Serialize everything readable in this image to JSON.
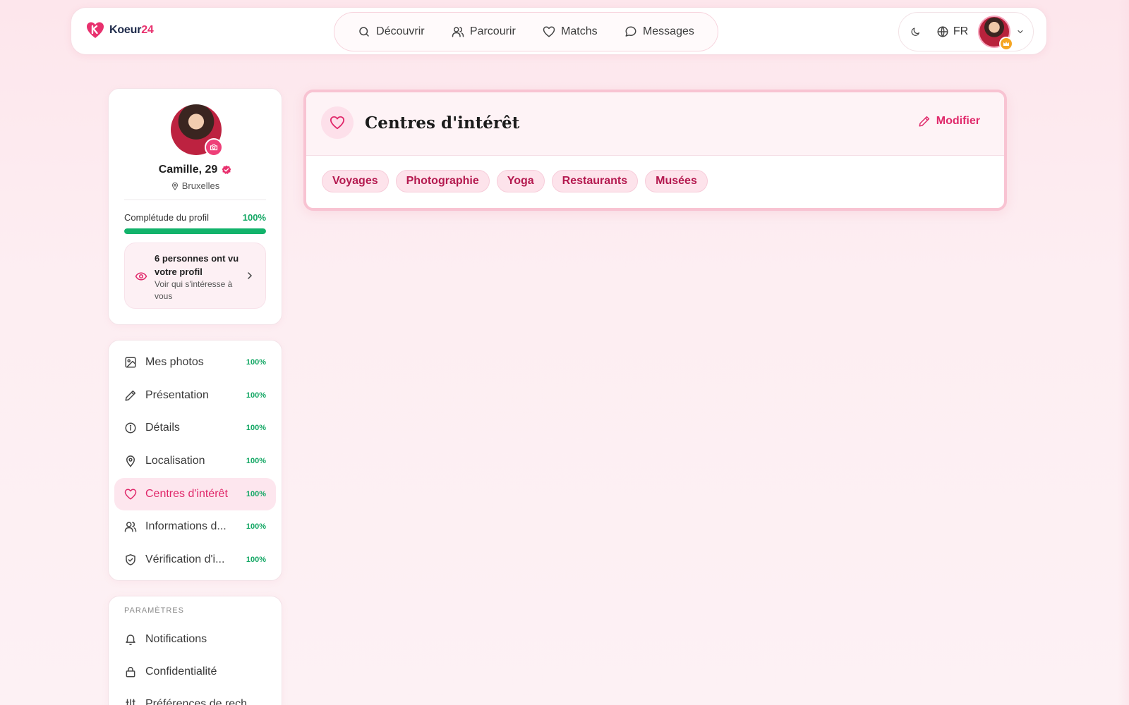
{
  "brand": {
    "name": "Koeur",
    "num": "24",
    "accent": "#e8316e"
  },
  "nav": [
    {
      "label": "Découvrir",
      "icon": "search-icon"
    },
    {
      "label": "Parcourir",
      "icon": "users-icon"
    },
    {
      "label": "Matchs",
      "icon": "heart-icon"
    },
    {
      "label": "Messages",
      "icon": "chat-icon"
    }
  ],
  "header": {
    "lang": "FR"
  },
  "profile": {
    "name": "Camille, 29",
    "location": "Bruxelles",
    "completion_label": "Complétude du profil",
    "completion_value": "100%",
    "completion_fraction": 1.0,
    "views_title": "6 personnes ont vu votre profil",
    "views_sub": "Voir qui s'intéresse à vous"
  },
  "menu": [
    {
      "label": "Mes photos",
      "pct": "100%",
      "icon": "image-icon"
    },
    {
      "label": "Présentation",
      "pct": "100%",
      "icon": "pencil-icon"
    },
    {
      "label": "Détails",
      "pct": "100%",
      "icon": "info-icon"
    },
    {
      "label": "Localisation",
      "pct": "100%",
      "icon": "pin-icon"
    },
    {
      "label": "Centres d'intérêt",
      "pct": "100%",
      "icon": "heart-icon"
    },
    {
      "label": "Informations d...",
      "pct": "100%",
      "icon": "users-icon"
    },
    {
      "label": "Vérification d'i...",
      "pct": "100%",
      "icon": "shield-icon"
    }
  ],
  "settings": {
    "title": "PARAMÈTRES",
    "items": [
      {
        "label": "Notifications",
        "icon": "bell-icon"
      },
      {
        "label": "Confidentialité",
        "icon": "lock-icon"
      },
      {
        "label": "Préférences de rech...",
        "icon": "sliders-icon"
      }
    ]
  },
  "interests": {
    "title": "Centres d'intérêt",
    "edit_label": "Modifier",
    "tags": [
      "Voyages",
      "Photographie",
      "Yoga",
      "Restaurants",
      "Musées"
    ]
  }
}
